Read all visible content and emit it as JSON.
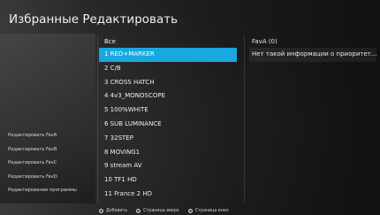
{
  "header": {
    "title": "Избранные Редактировать"
  },
  "left_menu": [
    "Редактировать FavA",
    "Редактировать FavB",
    "Редактировать FavC",
    "Редактировать FavD",
    "Редактирование программы"
  ],
  "channel_list": {
    "header": "Все",
    "items": [
      "1 RED+MARKER",
      "2 C/B",
      "3 CROSS HATCH",
      "4 4v3_MONOSCOPE",
      "5 100%WHITE",
      "6 SUB LUMINANCE",
      "7 32STEP",
      "8 MOVING1",
      "9 stream AV",
      "10 TF1 HD",
      "11 France 2 HD"
    ],
    "selected_index": 0
  },
  "fav_panel": {
    "header": "FavA (0)",
    "info": "Нет такой информации о приоритет..."
  },
  "footer": {
    "items": [
      {
        "icon": "ok-icon",
        "glyph": "⊙",
        "label": "Добавить"
      },
      {
        "icon": "page-up-icon",
        "glyph": "①",
        "label": "Страница вверх"
      },
      {
        "icon": "page-down-icon",
        "glyph": "②",
        "label": "Страница вниз"
      }
    ]
  },
  "colors": {
    "selection": "#19a7e0"
  }
}
